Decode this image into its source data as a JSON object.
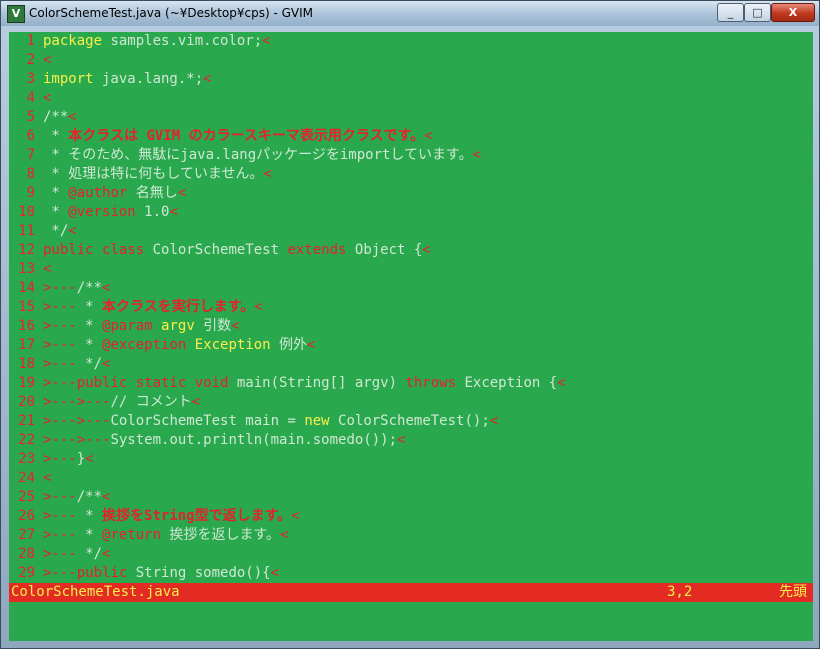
{
  "window": {
    "title": "ColorSchemeTest.java (~¥Desktop¥cps) - GVIM",
    "icon": "vim-icon",
    "controls": {
      "minimize": "_",
      "maximize": "□",
      "close": "X"
    }
  },
  "colors": {
    "background": "#2aa84e",
    "line_number": "#e8242a",
    "keyword": "#e4222a",
    "yellow": "#f7f04a",
    "normal_text": "#cfe8d4",
    "statusline_bg": "#e32b24",
    "statusline_fg": "#f3f04a"
  },
  "editor": {
    "lines": [
      {
        "n": "1",
        "segs": [
          [
            "yellow",
            "package"
          ],
          [
            "plain",
            " samples.vim.color;"
          ],
          [
            "eol",
            "<"
          ]
        ]
      },
      {
        "n": "2",
        "segs": [
          [
            "eol",
            "<"
          ]
        ]
      },
      {
        "n": "3",
        "segs": [
          [
            "yellow",
            "import"
          ],
          [
            "plain",
            " java.lang.*;"
          ],
          [
            "eol",
            "<"
          ]
        ]
      },
      {
        "n": "4",
        "segs": [
          [
            "eol",
            "<"
          ]
        ]
      },
      {
        "n": "5",
        "segs": [
          [
            "plain",
            "/**"
          ],
          [
            "eol",
            "<"
          ]
        ]
      },
      {
        "n": "6",
        "segs": [
          [
            "plain",
            " * "
          ],
          [
            "boldred",
            "本クラスは GVIM のカラースキーマ表示用クラスです。"
          ],
          [
            "eol",
            "<"
          ]
        ]
      },
      {
        "n": "7",
        "segs": [
          [
            "plain",
            " * そのため、無駄にjava.langパッケージをimportしています。"
          ],
          [
            "eol",
            "<"
          ]
        ]
      },
      {
        "n": "8",
        "segs": [
          [
            "plain",
            " * 処理は特に何もしていません。"
          ],
          [
            "eol",
            "<"
          ]
        ]
      },
      {
        "n": "9",
        "segs": [
          [
            "plain",
            " * "
          ],
          [
            "red",
            "@author"
          ],
          [
            "plain",
            " 名無し"
          ],
          [
            "eol",
            "<"
          ]
        ]
      },
      {
        "n": "10",
        "segs": [
          [
            "plain",
            " * "
          ],
          [
            "red",
            "@version"
          ],
          [
            "plain",
            " 1.0"
          ],
          [
            "eol",
            "<"
          ]
        ]
      },
      {
        "n": "11",
        "segs": [
          [
            "plain",
            " */"
          ],
          [
            "eol",
            "<"
          ]
        ]
      },
      {
        "n": "12",
        "segs": [
          [
            "red",
            "public class"
          ],
          [
            "plain",
            " ColorSchemeTest "
          ],
          [
            "red",
            "extends"
          ],
          [
            "plain",
            " Object {"
          ],
          [
            "eol",
            "<"
          ]
        ]
      },
      {
        "n": "13",
        "segs": [
          [
            "eol",
            "<"
          ]
        ]
      },
      {
        "n": "14",
        "segs": [
          [
            "tab",
            ">---"
          ],
          [
            "plain",
            "/**"
          ],
          [
            "eol",
            "<"
          ]
        ]
      },
      {
        "n": "15",
        "segs": [
          [
            "tab",
            ">---"
          ],
          [
            "plain",
            " * "
          ],
          [
            "boldred",
            "本クラスを実行します。"
          ],
          [
            "eol",
            "<"
          ]
        ]
      },
      {
        "n": "16",
        "segs": [
          [
            "tab",
            ">---"
          ],
          [
            "plain",
            " * "
          ],
          [
            "red",
            "@param"
          ],
          [
            "plain",
            " "
          ],
          [
            "yellow",
            "argv"
          ],
          [
            "plain",
            " 引数"
          ],
          [
            "eol",
            "<"
          ]
        ]
      },
      {
        "n": "17",
        "segs": [
          [
            "tab",
            ">---"
          ],
          [
            "plain",
            " * "
          ],
          [
            "red",
            "@exception"
          ],
          [
            "plain",
            " "
          ],
          [
            "yellow",
            "Exception"
          ],
          [
            "plain",
            " 例外"
          ],
          [
            "eol",
            "<"
          ]
        ]
      },
      {
        "n": "18",
        "segs": [
          [
            "tab",
            ">---"
          ],
          [
            "plain",
            " */"
          ],
          [
            "eol",
            "<"
          ]
        ]
      },
      {
        "n": "19",
        "segs": [
          [
            "tab",
            ">---"
          ],
          [
            "red",
            "public static void"
          ],
          [
            "plain",
            " main(String[] argv) "
          ],
          [
            "red",
            "throws"
          ],
          [
            "plain",
            " Exception {"
          ],
          [
            "eol",
            "<"
          ]
        ]
      },
      {
        "n": "20",
        "segs": [
          [
            "tab",
            ">--->---"
          ],
          [
            "plain",
            "// コメント"
          ],
          [
            "eol",
            "<"
          ]
        ]
      },
      {
        "n": "21",
        "segs": [
          [
            "tab",
            ">--->---"
          ],
          [
            "plain",
            "ColorSchemeTest main = "
          ],
          [
            "yellow",
            "new"
          ],
          [
            "plain",
            " ColorSchemeTest();"
          ],
          [
            "eol",
            "<"
          ]
        ]
      },
      {
        "n": "22",
        "segs": [
          [
            "tab",
            ">--->---"
          ],
          [
            "plain",
            "System.out.println(main.somedo());"
          ],
          [
            "eol",
            "<"
          ]
        ]
      },
      {
        "n": "23",
        "segs": [
          [
            "tab",
            ">---"
          ],
          [
            "plain",
            "}"
          ],
          [
            "eol",
            "<"
          ]
        ]
      },
      {
        "n": "24",
        "segs": [
          [
            "eol",
            "<"
          ]
        ]
      },
      {
        "n": "25",
        "segs": [
          [
            "tab",
            ">---"
          ],
          [
            "plain",
            "/**"
          ],
          [
            "eol",
            "<"
          ]
        ]
      },
      {
        "n": "26",
        "segs": [
          [
            "tab",
            ">---"
          ],
          [
            "plain",
            " * "
          ],
          [
            "boldred",
            "挨拶をString型で返します。"
          ],
          [
            "eol",
            "<"
          ]
        ]
      },
      {
        "n": "27",
        "segs": [
          [
            "tab",
            ">---"
          ],
          [
            "plain",
            " * "
          ],
          [
            "red",
            "@return"
          ],
          [
            "plain",
            " 挨拶を返します。"
          ],
          [
            "eol",
            "<"
          ]
        ]
      },
      {
        "n": "28",
        "segs": [
          [
            "tab",
            ">---"
          ],
          [
            "plain",
            " */"
          ],
          [
            "eol",
            "<"
          ]
        ]
      },
      {
        "n": "29",
        "segs": [
          [
            "tab",
            ">---"
          ],
          [
            "red",
            "public"
          ],
          [
            "plain",
            " String somedo(){"
          ],
          [
            "eol",
            "<"
          ]
        ]
      }
    ]
  },
  "statusline": {
    "filename": "ColorSchemeTest.java",
    "position": "3,2",
    "percent": "先頭"
  },
  "cmdline": {
    "text": ""
  }
}
